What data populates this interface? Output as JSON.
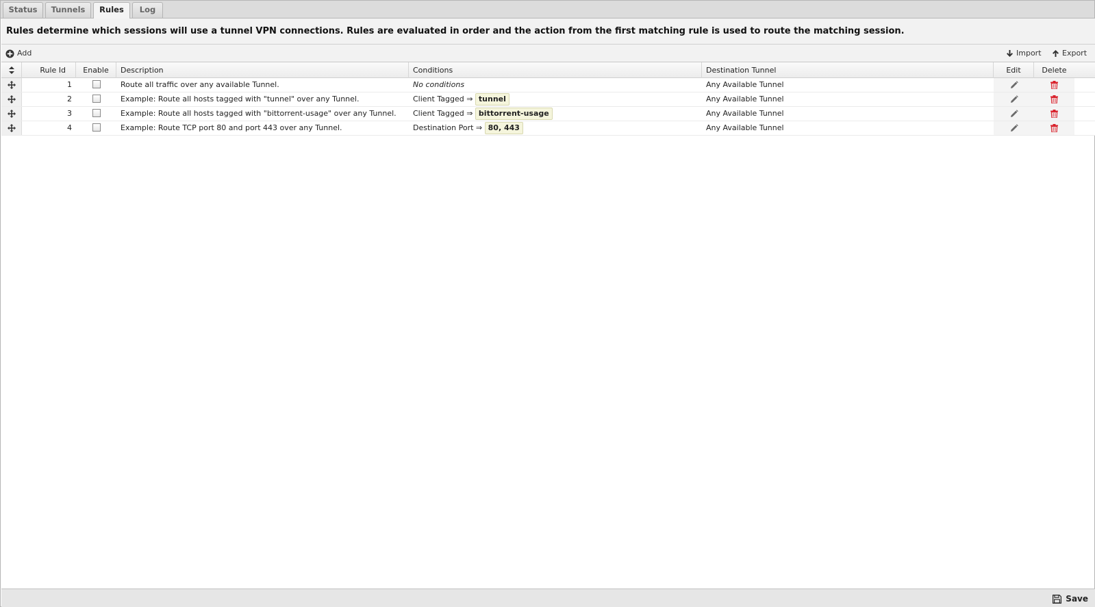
{
  "tabs": [
    {
      "label": "Status"
    },
    {
      "label": "Tunnels"
    },
    {
      "label": "Rules"
    },
    {
      "label": "Log"
    }
  ],
  "info": {
    "text": "Rules determine which sessions will use a tunnel VPN connections. Rules are evaluated in order and the action from the first matching rule is used to route the matching session."
  },
  "toolbar": {
    "add_label": "Add",
    "import_label": "Import",
    "export_label": "Export"
  },
  "grid": {
    "columns": {
      "rule_id": "Rule Id",
      "enable": "Enable",
      "description": "Description",
      "conditions": "Conditions",
      "destination": "Destination Tunnel",
      "edit": "Edit",
      "delete": "Delete"
    },
    "rows": [
      {
        "id": "1",
        "enabled": false,
        "description": "Route all traffic over any available Tunnel.",
        "condition_label": "No conditions",
        "condition_value": "",
        "destination": "Any Available Tunnel"
      },
      {
        "id": "2",
        "enabled": false,
        "description": "Example: Route all hosts tagged with \"tunnel\" over any Tunnel.",
        "condition_label": "Client Tagged ⇒",
        "condition_value": "tunnel",
        "destination": "Any Available Tunnel"
      },
      {
        "id": "3",
        "enabled": false,
        "description": "Example: Route all hosts tagged with \"bittorrent-usage\" over any Tunnel.",
        "condition_label": "Client Tagged ⇒",
        "condition_value": "bittorrent-usage",
        "destination": "Any Available Tunnel"
      },
      {
        "id": "4",
        "enabled": false,
        "description": "Example: Route TCP port 80 and port 443 over any Tunnel.",
        "condition_label": "Destination Port ⇒",
        "condition_value": "80, 443",
        "destination": "Any Available Tunnel"
      }
    ]
  },
  "footer": {
    "save_label": "Save"
  },
  "colors": {
    "delete_icon": "#d9232d",
    "tag_bg": "#f5f5dc"
  },
  "icons": {
    "add": "plus-circle-icon",
    "import": "arrow-down-icon",
    "export": "arrow-up-icon",
    "sort": "sort-updown-icon",
    "drag": "move-icon",
    "edit": "pencil-icon",
    "delete": "trash-icon",
    "save": "floppy-disk-icon"
  }
}
